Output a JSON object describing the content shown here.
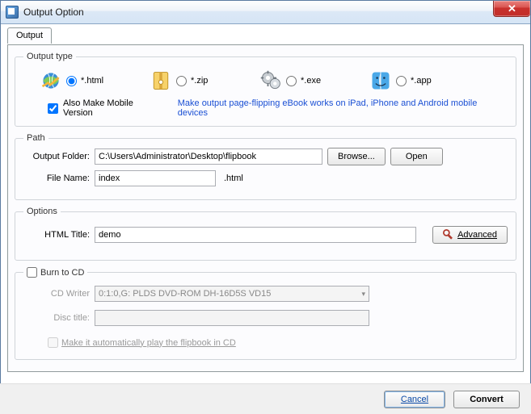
{
  "window": {
    "title": "Output Option"
  },
  "tab": {
    "label": "Output"
  },
  "outputType": {
    "legend": "Output type",
    "html": "*.html",
    "zip": "*.zip",
    "exe": "*.exe",
    "app": "*.app",
    "alsoMobile": "Also Make Mobile Version",
    "mobileHint": "Make output page-flipping eBook works on iPad, iPhone and Android mobile devices"
  },
  "path": {
    "legend": "Path",
    "outputFolderLabel": "Output Folder:",
    "outputFolderValue": "C:\\Users\\Administrator\\Desktop\\flipbook",
    "browse": "Browse...",
    "open": "Open",
    "fileNameLabel": "File Name:",
    "fileNameValue": "index",
    "ext": ".html"
  },
  "options": {
    "legend": "Options",
    "htmlTitleLabel": "HTML Title:",
    "htmlTitleValue": "demo",
    "advanced": "Advanced"
  },
  "burn": {
    "legend": "Burn to CD",
    "writerLabel": "CD Writer",
    "writerValue": "0:1:0,G: PLDS     DVD-ROM DH-16D5S VD15",
    "discTitleLabel": "Disc title:",
    "discTitleValue": "",
    "autoplay": "Make it automatically play the flipbook in CD"
  },
  "footer": {
    "cancel": "Cancel",
    "convert": "Convert"
  }
}
